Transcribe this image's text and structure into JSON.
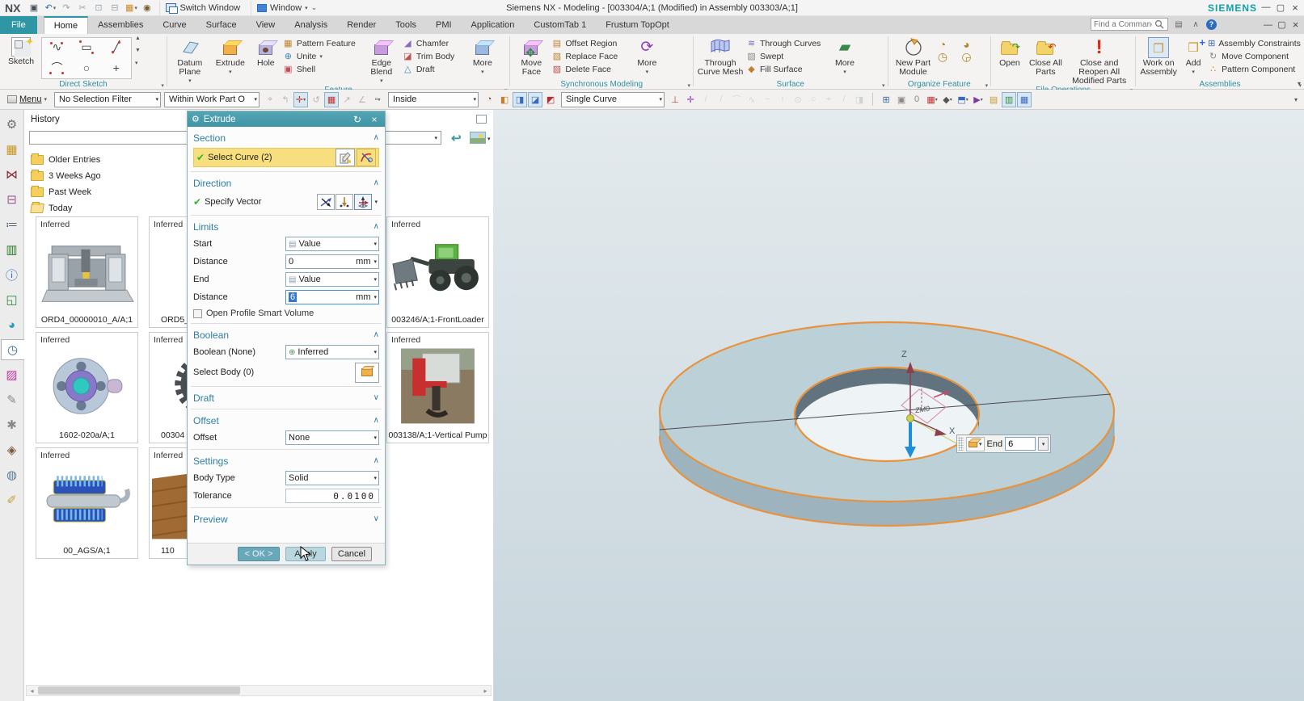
{
  "colors": {
    "accent_teal": "#3E96A6",
    "highlight_yellow": "#F7DE7E",
    "edge_orange": "#E8933C",
    "selection_blue": "#3575D3",
    "check_green": "#2DB52D"
  },
  "titlebar": {
    "logo": "NX",
    "quick_access": [
      {
        "name": "save-icon",
        "glyph": "▣",
        "color": "#44505a",
        "caret": ""
      },
      {
        "name": "undo-icon",
        "glyph": "↶",
        "color": "#2a6ac0",
        "caret": "▾"
      },
      {
        "name": "redo-icon",
        "glyph": "↷",
        "color": "#9aa4ac",
        "caret": ""
      },
      {
        "name": "cut-icon",
        "glyph": "✂",
        "color": "#9aa4ac",
        "caret": ""
      },
      {
        "name": "copy-icon",
        "glyph": "⊡",
        "color": "#9aa4ac",
        "caret": ""
      },
      {
        "name": "paste-icon",
        "glyph": "⊟",
        "color": "#9aa4ac",
        "caret": ""
      },
      {
        "name": "part-box-icon",
        "glyph": "▦",
        "color": "#d08a2a",
        "caret": "▾"
      },
      {
        "name": "touch-mode-icon",
        "glyph": "◉",
        "color": "#7a5a2a",
        "caret": ""
      }
    ],
    "switch_window_label": "Switch Window",
    "window_label": "Window",
    "window_caret": "▾",
    "customize_caret": "⌄",
    "title": "Siemens NX - Modeling - [003304/A;1 (Modified)  in Assembly 003303/A;1]",
    "brand": "SIEMENS",
    "window_controls": {
      "minimize": "—",
      "restore": "▢",
      "close": "×"
    }
  },
  "tab_bar": {
    "file_tab": "File",
    "tabs": [
      {
        "name": "tab-home",
        "label": "Home",
        "state": "active"
      },
      {
        "name": "tab-assemblies",
        "label": "Assemblies"
      },
      {
        "name": "tab-curve",
        "label": "Curve"
      },
      {
        "name": "tab-surface",
        "label": "Surface"
      },
      {
        "name": "tab-view",
        "label": "View"
      },
      {
        "name": "tab-analysis",
        "label": "Analysis"
      },
      {
        "name": "tab-render",
        "label": "Render"
      },
      {
        "name": "tab-tools",
        "label": "Tools"
      },
      {
        "name": "tab-pmi",
        "label": "PMI"
      },
      {
        "name": "tab-application",
        "label": "Application"
      },
      {
        "name": "tab-customtab-1",
        "label": "CustomTab 1"
      },
      {
        "name": "tab-frustum-topopt",
        "label": "Frustum TopOpt"
      }
    ],
    "find_command_placeholder": "Find a Command",
    "help_glyph": "?"
  },
  "ribbon": {
    "groups": {
      "direct_sketch": {
        "label": "Direct Sketch",
        "sketch": "Sketch"
      },
      "feature": {
        "label": "Feature",
        "datum_plane": "Datum Plane",
        "extrude": "Extrude",
        "hole": "Hole",
        "pattern_feature": "Pattern Feature",
        "unite": "Unite",
        "shell": "Shell",
        "edge_blend": "Edge Blend",
        "chamfer": "Chamfer",
        "trim_body": "Trim Body",
        "draft": "Draft",
        "more": "More"
      },
      "synchronous_modeling": {
        "label": "Synchronous Modeling",
        "move_face": "Move Face",
        "offset_region": "Offset Region",
        "replace_face": "Replace Face",
        "delete_face": "Delete Face",
        "more": "More"
      },
      "surface": {
        "label": "Surface",
        "through_curve_mesh": "Through Curve Mesh",
        "through_curves": "Through Curves",
        "swept": "Swept",
        "fill_surface": "Fill Surface",
        "more": "More"
      },
      "organize_feature": {
        "label": "Organize Feature",
        "new_part_module": "New Part Module"
      },
      "file_operations": {
        "label": "File Operations",
        "open": "Open",
        "close_all_parts": "Close All Parts",
        "close_reopen": "Close and Reopen All Modified Parts"
      },
      "assemblies": {
        "label": "Assemblies",
        "work_on_assembly": "Work on Assembly",
        "add": "Add",
        "assembly_constraints": "Assembly Constraints",
        "move_component": "Move Component",
        "pattern_component": "Pattern Component"
      }
    }
  },
  "selection_bar": {
    "menu": "Menu",
    "selection_filter": "No Selection Filter",
    "selection_scope": "Within Work Part O",
    "snap_mode": "Inside",
    "curve_rule": "Single Curve",
    "snap_icons": [
      {
        "name": "select-handles-icon",
        "glyph": "⌖",
        "color": "#556",
        "state": "dim",
        "caret": ""
      },
      {
        "name": "select-previous-icon",
        "glyph": "↰",
        "color": "#556",
        "state": "dim",
        "caret": ""
      },
      {
        "name": "snap-point-icon",
        "glyph": "✛",
        "color": "#c03030",
        "state": "pressed",
        "caret": "▾"
      },
      {
        "name": "rotate-selection-icon",
        "glyph": "↺",
        "color": "#556",
        "state": "dim",
        "caret": ""
      },
      {
        "name": "grid-snap-icon",
        "glyph": "▦",
        "color": "#c03030",
        "state": "pressed",
        "caret": ""
      },
      {
        "name": "vector-snap-icon",
        "glyph": "↗",
        "color": "#556",
        "state": "dim",
        "caret": ""
      },
      {
        "name": "angle-snap-icon",
        "glyph": "∠",
        "color": "#556",
        "state": "dim",
        "caret": ""
      },
      {
        "name": "rectangle-select-icon",
        "glyph": "▫",
        "color": "#556",
        "caret": "▾"
      }
    ],
    "view_icons": [
      {
        "name": "shaded-edges-icon",
        "glyph": "◔",
        "color": "#8a4a2a",
        "caret": ""
      },
      {
        "name": "shaded-icon",
        "glyph": "◧",
        "color": "#c08030",
        "caret": ""
      },
      {
        "name": "wireframe-icon",
        "glyph": "◨",
        "color": "#3a6ac0",
        "state": "pressed",
        "caret": ""
      },
      {
        "name": "studio-icon",
        "glyph": "◪",
        "color": "#3a6ac0",
        "state": "pressed",
        "caret": ""
      },
      {
        "name": "face-analysis-icon",
        "glyph": "◩",
        "color": "#b03030",
        "caret": ""
      }
    ],
    "curve_icons": [
      {
        "name": "stop-at-intersection-icon",
        "glyph": "⊥",
        "color": "#b04040",
        "caret": ""
      },
      {
        "name": "follow-fillet-icon",
        "glyph": "✛",
        "color": "#8a3ac0",
        "caret": ""
      },
      {
        "name": "line-tool-icon",
        "glyph": "/",
        "color": "#9aa4ac",
        "state": "dim",
        "caret": ""
      },
      {
        "name": "chamfer-line-icon",
        "glyph": "/",
        "color": "#9aa4ac",
        "state": "dim",
        "caret": ""
      },
      {
        "name": "arc-tool-icon",
        "glyph": "⌒",
        "color": "#9aa4ac",
        "state": "dim",
        "caret": ""
      },
      {
        "name": "spline-tool-icon",
        "glyph": "∿",
        "color": "#9aa4ac",
        "state": "dim",
        "caret": ""
      },
      {
        "name": "curve-tool-icon",
        "glyph": "~",
        "color": "#9aa4ac",
        "state": "dim",
        "caret": ""
      },
      {
        "name": "arrow-up-icon",
        "glyph": "↑",
        "color": "#9aa4ac",
        "state": "dim",
        "caret": ""
      },
      {
        "name": "point-circle-icon",
        "glyph": "⊙",
        "color": "#9aa4ac",
        "state": "dim",
        "caret": ""
      },
      {
        "name": "circle-tool-icon",
        "glyph": "○",
        "color": "#9aa4ac",
        "state": "dim",
        "caret": ""
      },
      {
        "name": "plus-tool-icon",
        "glyph": "+",
        "color": "#9aa4ac",
        "state": "dim",
        "caret": ""
      },
      {
        "name": "slash-tool-icon",
        "glyph": "/",
        "color": "#9aa4ac",
        "state": "dim",
        "caret": ""
      },
      {
        "name": "sheet-tool-icon",
        "glyph": "◨",
        "color": "#9aa4ac",
        "state": "dim",
        "caret": ""
      }
    ],
    "window_icons": [
      {
        "name": "show-hide-icon",
        "glyph": "⊞",
        "color": "#3a6a9a",
        "caret": ""
      },
      {
        "name": "immersive-icon",
        "glyph": "▣",
        "color": "#888888",
        "caret": ""
      },
      {
        "name": "zero-icon",
        "glyph": "0",
        "color": "#888888",
        "caret": ""
      },
      {
        "name": "edit-section-icon",
        "glyph": "▦",
        "color": "#c03030",
        "caret": "▾"
      },
      {
        "name": "effects-icon",
        "glyph": "◆",
        "color": "#555555",
        "caret": "▾"
      },
      {
        "name": "render-style-icon",
        "glyph": "⬒",
        "color": "#3a6ac0",
        "caret": "▾"
      },
      {
        "name": "play-icon",
        "glyph": "▶",
        "color": "#7a3aa0",
        "caret": "▾"
      },
      {
        "name": "layer-folder-icon",
        "glyph": "▤",
        "color": "#c9992a",
        "caret": ""
      },
      {
        "name": "window-split-icon",
        "glyph": "▥",
        "color": "#3a8a4a",
        "state": "pressed",
        "caret": ""
      },
      {
        "name": "window-cascade-icon",
        "glyph": "▦",
        "color": "#3a6ac0",
        "state": "pressed",
        "caret": ""
      }
    ],
    "options_caret": "▾"
  },
  "resource_bar": {
    "icons": [
      {
        "name": "roles-gear-icon",
        "glyph": "⚙",
        "color": "#6f6f6f"
      },
      {
        "name": "assembly-navigator-icon",
        "glyph": "▦",
        "color": "#c9992a"
      },
      {
        "name": "constraint-navigator-icon",
        "glyph": "⋈",
        "color": "#8a2a3a"
      },
      {
        "name": "part-navigator-icon",
        "glyph": "⊟",
        "color": "#9a5a8a"
      },
      {
        "name": "operation-navigator-icon",
        "glyph": "≔",
        "color": "#556677"
      },
      {
        "name": "reuse-library-icon",
        "glyph": "▥",
        "color": "#2a7a2a"
      },
      {
        "name": "hd3d-tools-icon",
        "glyph": "ⓘ",
        "color": "#2a6ac0"
      },
      {
        "name": "web-browser-icon",
        "glyph": "◱",
        "color": "#3a8a4a"
      },
      {
        "name": "internet-icon",
        "glyph": "◕",
        "color": "#2a9ac0"
      },
      {
        "name": "history-icon",
        "glyph": "◷",
        "color": "#3a6a9a",
        "state": "active"
      },
      {
        "name": "materials-icon",
        "glyph": "▨",
        "color": "#c03aa0"
      },
      {
        "name": "process-studio-icon",
        "glyph": "✎",
        "color": "#888888"
      },
      {
        "name": "manufacturing-wizards-icon",
        "glyph": "✱",
        "color": "#888888"
      },
      {
        "name": "roles-icon",
        "glyph": "◈",
        "color": "#7a5a3a"
      },
      {
        "name": "system-scenes-icon",
        "glyph": "◍",
        "color": "#5a7a9a"
      },
      {
        "name": "drafting-icon",
        "glyph": "✐",
        "color": "#c0a03a"
      }
    ]
  },
  "history": {
    "title": "History",
    "search_value": "",
    "folders": [
      {
        "name": "folder-older-entries",
        "label": "Older Entries",
        "state": "closed"
      },
      {
        "name": "folder-3-weeks-ago",
        "label": "3 Weeks Ago",
        "state": "closed"
      },
      {
        "name": "folder-past-week",
        "label": "Past Week",
        "state": "closed"
      },
      {
        "name": "folder-today",
        "label": "Today",
        "state": "open"
      }
    ],
    "cards": [
      {
        "badge": "Inferred",
        "caption": "ORD4_00000010_A/A;1",
        "thumb": "cnc-machine"
      },
      {
        "badge": "Inferred",
        "caption": "ORD5_",
        "thumb": "hidden-part"
      },
      {
        "badge": "Inferred",
        "caption": "003246/A;1-FrontLoader",
        "thumb": "front-loader"
      },
      {
        "badge": "Inferred",
        "caption": "1602-020a/A;1",
        "thumb": "hub-flange"
      },
      {
        "badge": "Inferred",
        "caption": "00304",
        "thumb": "gear"
      },
      {
        "badge": "Inferred",
        "caption": "003138/A;1-Vertical Pump",
        "thumb": "vertical-pump"
      },
      {
        "badge": "Inferred",
        "caption": "00_AGS/A;1",
        "thumb": "rotor-assembly"
      },
      {
        "badge": "Inferred",
        "caption": "110",
        "thumb": "wood-fixture"
      }
    ]
  },
  "dialog": {
    "title": "Extrude",
    "sections": {
      "section": "Section",
      "direction": "Direction",
      "limits": "Limits",
      "boolean": "Boolean",
      "draft": "Draft",
      "offset": "Offset",
      "settings": "Settings",
      "preview": "Preview"
    },
    "select_curve": "Select Curve (2)",
    "specify_vector": "Specify Vector",
    "limits": {
      "start_label": "Start",
      "start_value": "Value",
      "distance1_label": "Distance",
      "distance1_value": "0",
      "unit": "mm",
      "end_label": "End",
      "end_value": "Value",
      "distance2_label": "Distance",
      "distance2_value": "6",
      "open_profile": "Open Profile Smart Volume"
    },
    "boolean": {
      "label": "Boolean (None)",
      "value": "Inferred",
      "select_body": "Select Body (0)"
    },
    "offset": {
      "label": "Offset",
      "value": "None"
    },
    "settings": {
      "body_type_label": "Body Type",
      "body_type_value": "Solid",
      "tolerance_label": "Tolerance",
      "tolerance_value": "0.0100"
    },
    "buttons": {
      "ok": "< OK >",
      "apply": "Apply",
      "cancel": "Cancel"
    }
  },
  "viewport": {
    "axis_z_label": "Z",
    "axis_x_label": "X",
    "csys_label": "ZM0",
    "onscreen_input": {
      "label": "End",
      "value": "6"
    }
  }
}
